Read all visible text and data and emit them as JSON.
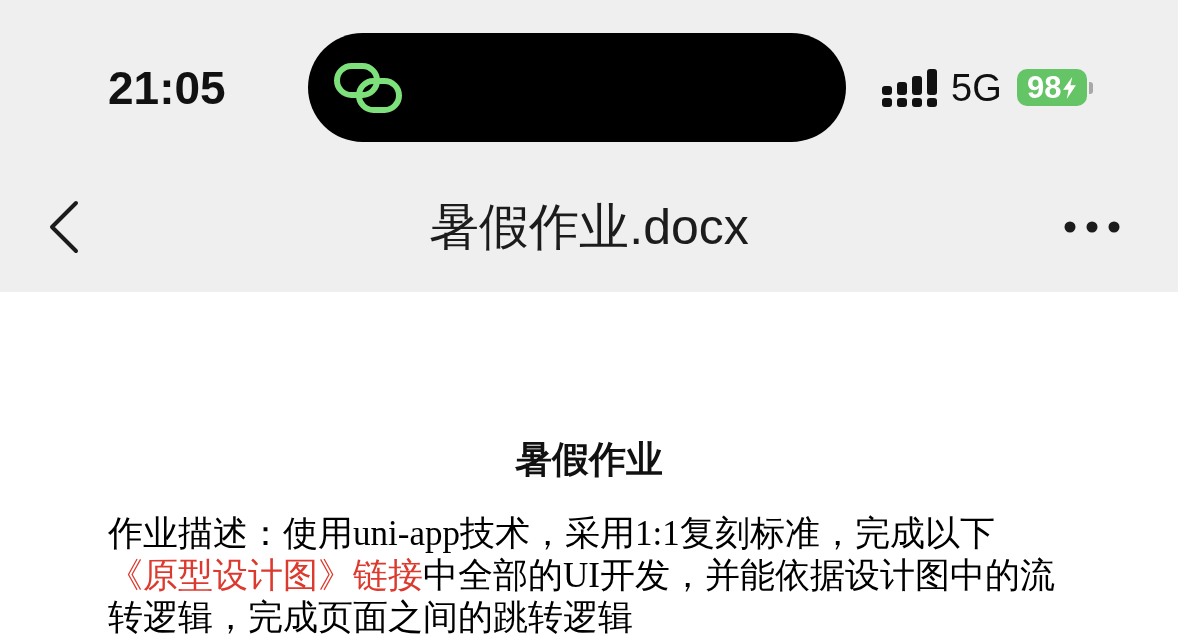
{
  "status_bar": {
    "time": "21:05",
    "network": "5G",
    "battery": "98",
    "charging": true
  },
  "nav_bar": {
    "title": "暑假作业.docx"
  },
  "document": {
    "title": "暑假作业",
    "paragraph": [
      {
        "kind": "text",
        "text": "作业描述：使用uni-app技术，采用1:1复刻标准，完成以下"
      },
      {
        "kind": "link",
        "text": "《原型设计图》链接"
      },
      {
        "kind": "text",
        "text": "中全部的UI开发，并能依据设计图中的流转逻辑，完成页面之间的跳转逻辑"
      }
    ]
  }
}
